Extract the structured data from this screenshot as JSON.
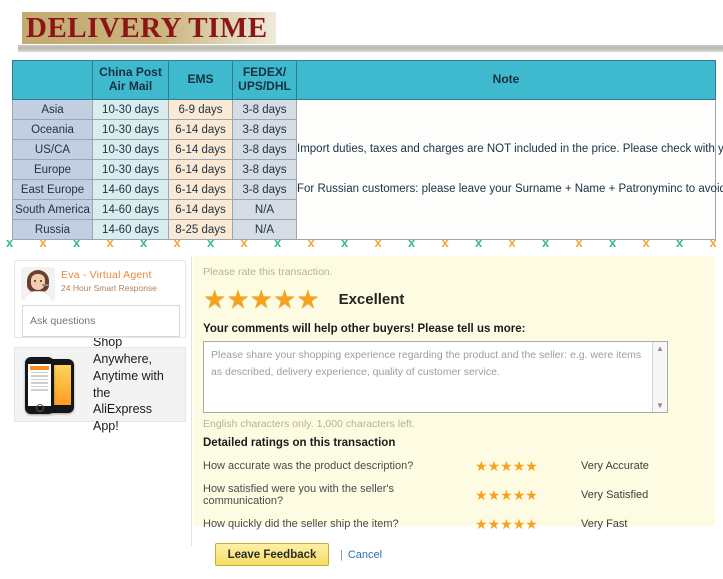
{
  "header": {
    "title": "DELIVERY TIME"
  },
  "delivery_table": {
    "columns": [
      "",
      "China Post Air Mail",
      "EMS",
      "FEDEX/ UPS/DHL",
      "Note"
    ],
    "column_labels": {
      "region": "",
      "china_post_line1": "China Post",
      "china_post_line2": "Air Mail",
      "ems": "EMS",
      "fedex_line1": "FEDEX/",
      "fedex_line2": "UPS/DHL",
      "note": "Note"
    },
    "rows": [
      {
        "region": "Asia",
        "china_post": "10-30 days",
        "ems": "6-9 days",
        "fedex": "3-8 days"
      },
      {
        "region": "Oceania",
        "china_post": "10-30 days",
        "ems": "6-14 days",
        "fedex": "3-8 days"
      },
      {
        "region": "US/CA",
        "china_post": "10-30 days",
        "ems": "6-14 days",
        "fedex": "3-8 days"
      },
      {
        "region": "Europe",
        "china_post": "10-30 days",
        "ems": "6-14 days",
        "fedex": "3-8 days"
      },
      {
        "region": "East Europe",
        "china_post": "14-60 days",
        "ems": "6-14 days",
        "fedex": "3-8 days"
      },
      {
        "region": "South America",
        "china_post": "14-60 days",
        "ems": "6-14 days",
        "fedex": "N/A"
      },
      {
        "region": "Russia",
        "china_post": "14-60 days",
        "ems": "8-25 days",
        "fedex": "N/A"
      }
    ],
    "note_paragraph_1": "Import duties, taxes and charges are NOT included in the price. Please check with your local customs office to determine what these additional costs will be prior to buying.",
    "note_paragraph_2": "For Russian customers: please leave your Surname + Name + Patronyminc to avoid the delivery problems."
  },
  "divider": {
    "glyph": "x",
    "count": 22,
    "color_a": "#3cb59b",
    "color_b": "#f0a83a"
  },
  "sidebar": {
    "eva": {
      "name": "Eva - Virtual Agent",
      "subtitle": "24 Hour Smart Response",
      "input_placeholder": "Ask questions",
      "input_value": ""
    },
    "app_promo": {
      "line1": "Shop Anywhere,",
      "line2": "Anytime with the",
      "line3": "AliExpress App!"
    }
  },
  "feedback": {
    "prompt": "Please rate this transaction.",
    "overall_stars": 5,
    "overall_label": "Excellent",
    "comments_label": "Your comments will help other buyers! Please tell us more:",
    "comment_placeholder": "Please share your shopping experience regarding the product and the seller: e.g. were items as described, delivery experience, quality of customer service.",
    "comment_value": "",
    "char_note": "English characters only. 1,000 characters left.",
    "detailed_title": "Detailed ratings on this transaction",
    "detailed_ratings": [
      {
        "question": "How accurate was the product description?",
        "stars": 5,
        "label": "Very Accurate"
      },
      {
        "question": "How satisfied were you with the seller's communication?",
        "stars": 5,
        "label": "Very Satisfied"
      },
      {
        "question": "How quickly did the seller ship the item?",
        "stars": 5,
        "label": "Very Fast"
      }
    ],
    "submit_label": "Leave Feedback",
    "separator": "|",
    "cancel_label": "Cancel"
  },
  "colors": {
    "table_header": "#3fb9cd",
    "title_text": "#8c1616",
    "title_bg": "#cbb47e",
    "star": "#f5a21e",
    "panel_bg": "#fdfce2",
    "button_bg": "#f6dc63",
    "link": "#2f6fa8"
  }
}
